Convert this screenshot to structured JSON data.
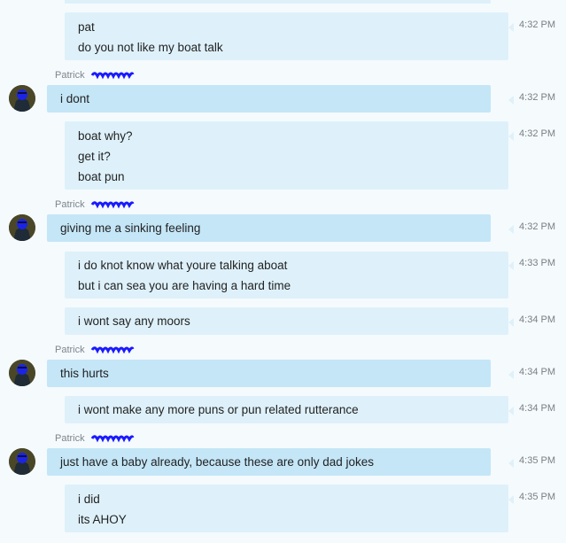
{
  "messages": [
    {
      "id": "m1",
      "kind": "out",
      "lines": [
        "pat",
        "do you not like my boat talk"
      ],
      "time": "4:32 PM"
    },
    {
      "id": "m2",
      "kind": "in",
      "sender": "Patrick",
      "lines": [
        "i dont"
      ],
      "time": "4:32 PM"
    },
    {
      "id": "m3",
      "kind": "out",
      "lines": [
        "boat why?",
        "get it?",
        "boat pun"
      ],
      "time": "4:32 PM"
    },
    {
      "id": "m4",
      "kind": "in",
      "sender": "Patrick",
      "lines": [
        "giving me a sinking feeling"
      ],
      "time": "4:32 PM"
    },
    {
      "id": "m5",
      "kind": "out",
      "lines": [
        "i do knot know what youre talking aboat",
        "but i can sea you are having a hard time"
      ],
      "time": "4:33 PM"
    },
    {
      "id": "m6",
      "kind": "out",
      "lines": [
        "i wont say any moors"
      ],
      "time": "4:34 PM"
    },
    {
      "id": "m7",
      "kind": "in",
      "sender": "Patrick",
      "lines": [
        "this hurts"
      ],
      "time": "4:34 PM"
    },
    {
      "id": "m8",
      "kind": "out",
      "lines": [
        "i wont make any more puns or pun related rutterance"
      ],
      "time": "4:34 PM"
    },
    {
      "id": "m9",
      "kind": "in",
      "sender": "Patrick",
      "lines": [
        "just have a baby already, because these are only dad jokes"
      ],
      "time": "4:35 PM"
    },
    {
      "id": "m10",
      "kind": "out",
      "lines": [
        "i did",
        "its AHOY"
      ],
      "time": "4:35 PM"
    }
  ],
  "colors": {
    "background": "#f5fafd",
    "incoming_bubble": "#c4e6f7",
    "outgoing_bubble": "#def1fa",
    "redaction": "#1a1aff"
  },
  "icons": {
    "avatar": "avatar-icon",
    "redaction": "redaction-scribble-icon"
  }
}
